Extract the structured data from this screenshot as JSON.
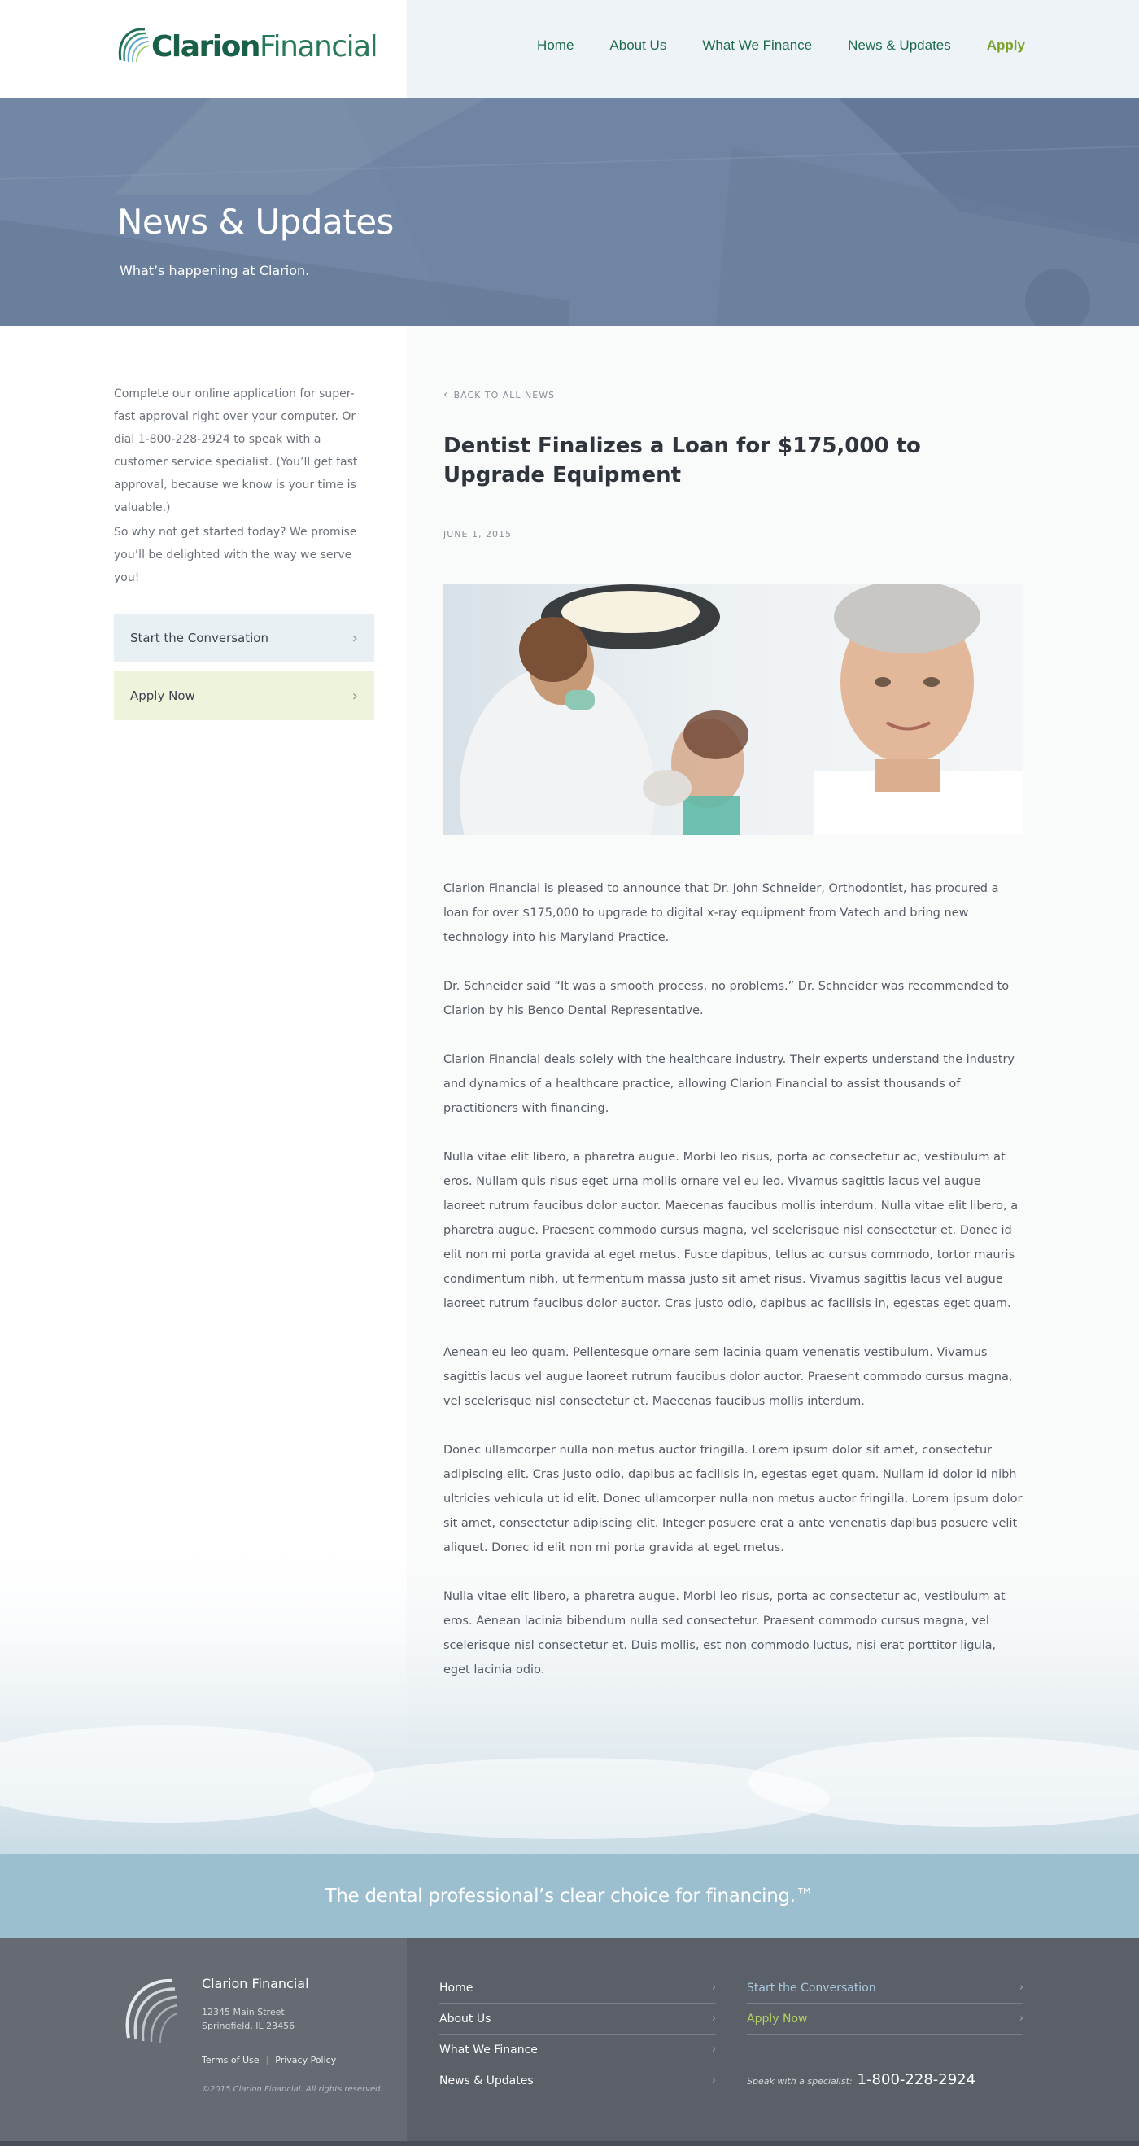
{
  "brand": {
    "name_bold": "Clarion",
    "name_light": "Financial",
    "green": "#1f6b4f",
    "accent_green": "#7aa12a"
  },
  "nav": {
    "items": [
      "Home",
      "About Us",
      "What We Finance",
      "News & Updates"
    ],
    "apply": "Apply"
  },
  "hero": {
    "title": "News & Updates",
    "subtitle": "What’s happening at Clarion."
  },
  "sidebar": {
    "paragraph1": "Complete our online application for super-fast approval right over your computer. Or dial 1-800-228-2924 to speak with a customer service specialist. (You’ll get fast approval, because we know is your time is valuable.)",
    "paragraph2": "So why not get started today? We promise you’ll be delighted with the way we serve you!",
    "cta_conversation": "Start the Conversation",
    "cta_apply": "Apply Now"
  },
  "article": {
    "back_label": "BACK TO ALL NEWS",
    "title": "Dentist Finalizes a Loan for $175,000 to Upgrade Equipment",
    "date": "JUNE 1, 2015",
    "paragraphs": [
      "Clarion Financial is pleased to announce that Dr. John Schneider, Orthodontist, has procured a loan for over $175,000 to upgrade to digital x-ray equipment from Vatech and bring new technology into his Maryland Practice.",
      "Dr. Schneider said “It was a smooth process, no problems.” Dr. Schneider was recommended to Clarion by his Benco Dental Representative.",
      "Clarion Financial deals solely with the healthcare industry. Their experts understand the industry and dynamics of a healthcare practice, allowing Clarion Financial to assist thousands of practitioners with financing.",
      "Nulla vitae elit libero, a pharetra augue. Morbi leo risus, porta ac consectetur ac, vestibulum at eros. Nullam quis risus eget urna mollis ornare vel eu leo. Vivamus sagittis lacus vel augue laoreet rutrum faucibus dolor auctor. Maecenas faucibus mollis interdum. Nulla vitae elit libero, a pharetra augue. Praesent commodo cursus magna, vel scelerisque nisl consectetur et. Donec id elit non mi porta gravida at eget metus. Fusce dapibus, tellus ac cursus commodo, tortor mauris condimentum nibh, ut fermentum massa justo sit amet risus. Vivamus sagittis lacus vel augue laoreet rutrum faucibus dolor auctor. Cras justo odio, dapibus ac facilisis in, egestas eget quam.",
      "Aenean eu leo quam. Pellentesque ornare sem lacinia quam venenatis vestibulum. Vivamus sagittis lacus vel augue laoreet rutrum faucibus dolor auctor. Praesent commodo cursus magna, vel scelerisque nisl consectetur et. Maecenas faucibus mollis interdum.",
      "Donec ullamcorper nulla non metus auctor fringilla. Lorem ipsum dolor sit amet, consectetur adipiscing elit. Cras justo odio, dapibus ac facilisis in, egestas eget quam. Nullam id dolor id nibh ultricies vehicula ut id elit. Donec ullamcorper nulla non metus auctor fringilla. Lorem ipsum dolor sit amet, consectetur adipiscing elit. Integer posuere erat a ante venenatis dapibus posuere velit aliquet. Donec id elit non mi porta gravida at eget metus.",
      "Nulla vitae elit libero, a pharetra augue. Morbi leo risus, porta ac consectetur ac, vestibulum at eros. Aenean lacinia bibendum nulla sed consectetur. Praesent commodo cursus magna, vel scelerisque nisl consectetur et. Duis mollis, est non commodo luctus, nisi erat porttitor ligula, eget lacinia odio."
    ]
  },
  "banner": {
    "text": "The dental professional’s clear choice for financing.™"
  },
  "footer": {
    "company": "Clarion Financial",
    "address_line1": "12345 Main Street",
    "address_line2": "Springfield, IL 23456",
    "terms": "Terms of Use",
    "privacy": "Privacy Policy",
    "copyright": "©2015 Clarion Financial. All rights reserved.",
    "links": [
      "Home",
      "About Us",
      "What We Finance",
      "News & Updates"
    ],
    "cta_conversation": "Start the Conversation",
    "cta_apply": "Apply Now",
    "phone_label": "Speak with a specialist:",
    "phone": "1-800-228-2924"
  },
  "icons": {
    "chevron_right": "chevron-right-icon",
    "chevron_left": "chevron-left-icon",
    "logo_mark": "swoosh-logo-icon"
  }
}
